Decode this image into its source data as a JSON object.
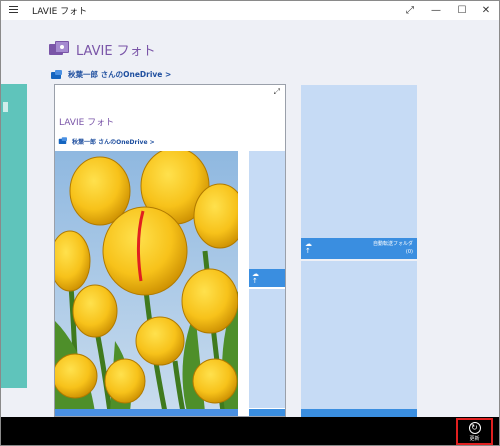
{
  "window": {
    "title": "LAVIE フォト",
    "menu_icon": "hamburger-icon",
    "controls": {
      "expand_icon": "⤢",
      "minimize_icon": "—",
      "maximize_icon": "☐",
      "close_icon": "✕"
    }
  },
  "header": {
    "app_name": "LAVIE フォト",
    "logo_icon": "photos-icon"
  },
  "onedrive_link": {
    "text": "秋葉一郎 さんのOneDrive >",
    "icon": "cloud-folder-icon"
  },
  "main_card": {
    "expand_icon": "⤢",
    "inner_title": "LAVIE フォト",
    "inner_link_text": "秋葉一郎 さんのOneDrive >"
  },
  "tiles": {
    "auto_transfer": {
      "label": "自動転送フォルダ",
      "count": "(0)",
      "icon": "upload-folder-icon"
    }
  },
  "appbar": {
    "refresh_label": "更新",
    "refresh_icon": "refresh-icon"
  },
  "colors": {
    "accent_purple": "#7a55a8",
    "tile_blue": "#3a8ee0",
    "tile_light": "#c6dbf5",
    "teal": "#5fc4bb",
    "highlight_red": "#e02020"
  }
}
